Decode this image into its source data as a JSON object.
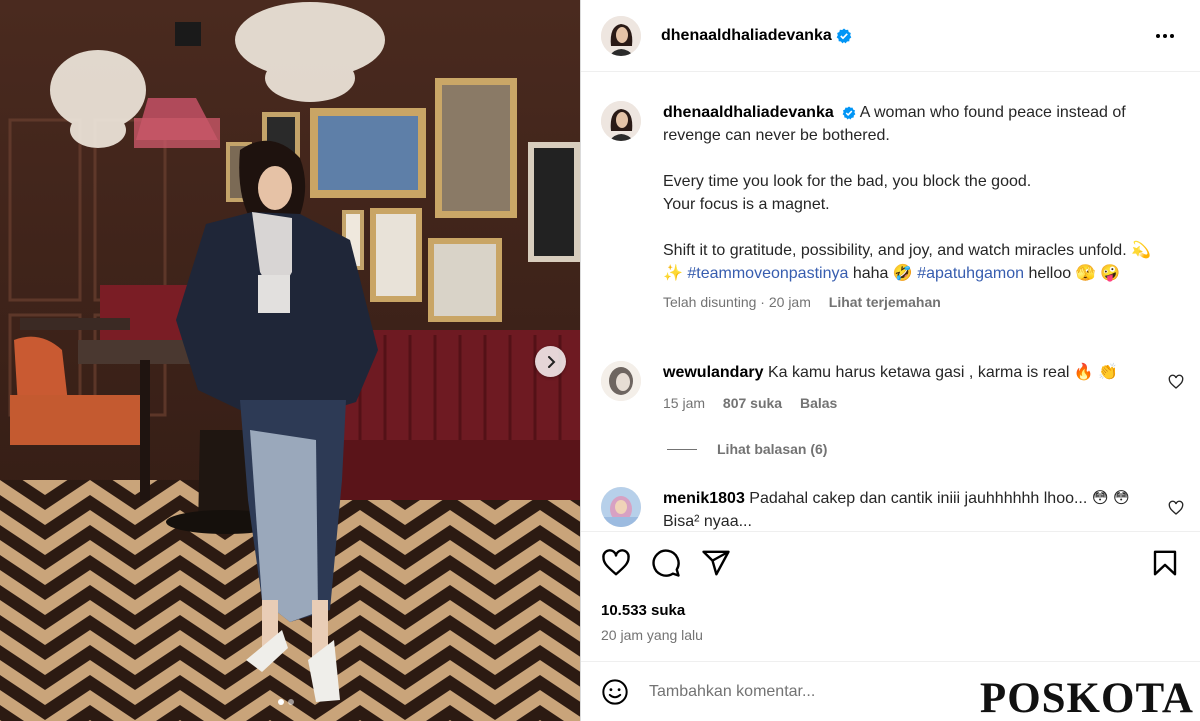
{
  "post": {
    "username": "dhenaaldhaliadevanka",
    "caption_lines": [
      "A woman who found peace instead of revenge can never be bothered.",
      "Every time you look for the bad, you block the good.",
      "Your focus is a magnet.",
      "Shift it to gratitude, possibility, and joy, and watch miracles unfold."
    ],
    "caption_tail": {
      "emoji_1": "💫 ✨",
      "hashtag_1": "#teammoveonpastinya",
      "word_1": "haha 🤣",
      "hashtag_2": "#apatuhgamon",
      "word_2": "helloo 🫣",
      "emoji_end": "🤪"
    },
    "edited_label": "Telah disunting",
    "edited_time": "20 jam",
    "translate_label": "Lihat terjemahan"
  },
  "comments": [
    {
      "username": "wewulandary",
      "text": "Ka kamu harus ketawa gasi , karma is real 🔥 👏",
      "time": "15 jam",
      "likes": "807 suka",
      "reply_label": "Balas",
      "view_replies": "Lihat balasan (6)"
    },
    {
      "username": "menik1803",
      "text": "Padahal cakep dan cantik iniii jauhhhhhh lhoo... 😳 😳 Bisa² nyaa..."
    }
  ],
  "actions": {
    "like_count": "10.533 suka",
    "posted_time": "20 jam yang lalu"
  },
  "comment_box": {
    "placeholder": "Tambahkan komentar..."
  },
  "watermark": "POSKOTA",
  "carousel": {
    "current": 1,
    "total": 2
  },
  "colors": {
    "hashtag": "#375daf",
    "verified": "#0095f6",
    "muted": "#737373",
    "border": "#dbdbdb"
  },
  "icons": [
    "heart-icon",
    "comment-icon",
    "share-icon",
    "bookmark-icon",
    "emoji-icon",
    "more-icon",
    "verified-icon",
    "chevron-right-icon"
  ]
}
